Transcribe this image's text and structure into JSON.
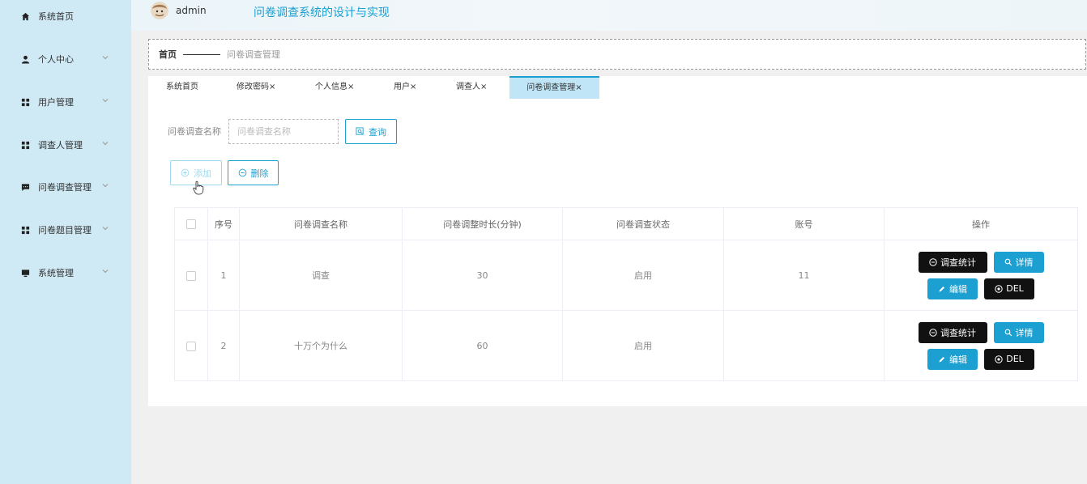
{
  "sidebar": {
    "items": [
      {
        "label": "系统首页",
        "icon": "home-icon"
      },
      {
        "label": "个人中心",
        "icon": "user-icon"
      },
      {
        "label": "用户管理",
        "icon": "grid-icon"
      },
      {
        "label": "调查人管理",
        "icon": "grid-icon"
      },
      {
        "label": "问卷调查管理",
        "icon": "chat-icon"
      },
      {
        "label": "问卷题目管理",
        "icon": "grid-icon"
      },
      {
        "label": "系统管理",
        "icon": "monitor-icon"
      }
    ]
  },
  "header": {
    "username": "admin",
    "title": "问卷调查系统的设计与实现"
  },
  "breadcrumb": {
    "home": "首页",
    "current": "问卷调查管理"
  },
  "tabs": [
    {
      "label": "系统首页"
    },
    {
      "label": "修改密码×"
    },
    {
      "label": "个人信息×"
    },
    {
      "label": "用户×"
    },
    {
      "label": "调查人×"
    },
    {
      "label": "问卷调查管理×"
    }
  ],
  "search": {
    "label": "问卷调查名称",
    "placeholder": "问卷调查名称",
    "button": "查询"
  },
  "actions": {
    "add": "添加",
    "delete": "删除"
  },
  "table": {
    "headers": [
      "序号",
      "问卷调查名称",
      "问卷调整时长(分钟)",
      "问卷调查状态",
      "账号",
      "操作"
    ],
    "rows": [
      {
        "index": "1",
        "name": "调查",
        "duration": "30",
        "status": "启用",
        "account": "11"
      },
      {
        "index": "2",
        "name": "十万个为什么",
        "duration": "60",
        "status": "启用",
        "account": ""
      }
    ],
    "row_buttons": {
      "stats": "调查统计",
      "detail": "详情",
      "edit": "编辑",
      "del": "DEL"
    }
  },
  "colors": {
    "accent": "#1c9fd1",
    "sidebar_bg": "#cfe9f5",
    "active_tab_bg": "#bfe5f7",
    "dark_button": "#111111"
  }
}
